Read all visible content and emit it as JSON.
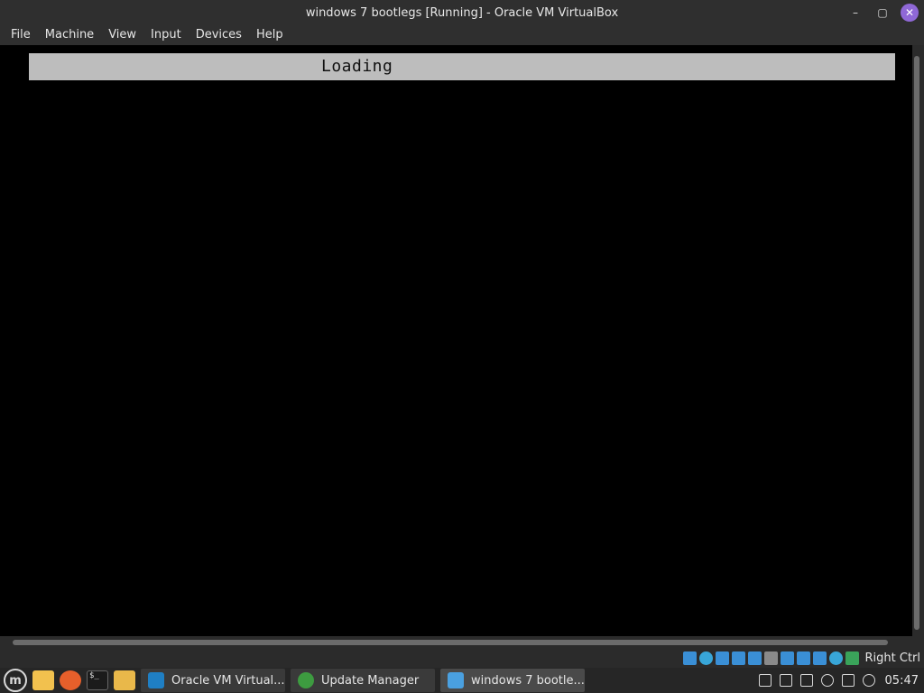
{
  "window": {
    "title": "windows 7 bootlegs [Running] - Oracle VM VirtualBox",
    "controls": {
      "minimize": "–",
      "maximize": "▢",
      "close": "✕"
    }
  },
  "menubar": {
    "items": [
      {
        "label": "File"
      },
      {
        "label": "Machine"
      },
      {
        "label": "View"
      },
      {
        "label": "Input"
      },
      {
        "label": "Devices"
      },
      {
        "label": "Help"
      }
    ]
  },
  "vm_screen": {
    "loading_text": "Loading"
  },
  "status_bar": {
    "icons": [
      "hard-disk-icon",
      "optical-drive-icon",
      "audio-icon",
      "network-icon",
      "usb-icon",
      "shared-folders-icon",
      "display-icon",
      "recording-icon",
      "virtualization-icon",
      "mouse-integration-icon",
      "keyboard-capture-icon"
    ],
    "host_key": "Right Ctrl"
  },
  "taskbar": {
    "menu_logo": "m",
    "quick_launch": [
      "show-desktop-icon",
      "firefox-icon",
      "terminal-icon",
      "files-icon"
    ],
    "terminal_glyph": "$_",
    "tasks": [
      {
        "label": "Oracle VM Virtual...",
        "icon": "virtualbox-icon"
      },
      {
        "label": "Update Manager",
        "icon": "update-manager-icon"
      },
      {
        "label": "windows 7 bootle...",
        "icon": "windows-vm-icon"
      }
    ],
    "tray_icons": [
      "clipboard-icon",
      "shield-icon",
      "removable-drive-icon",
      "user-icon",
      "network-icon",
      "volume-icon"
    ],
    "clock": "05:47"
  }
}
